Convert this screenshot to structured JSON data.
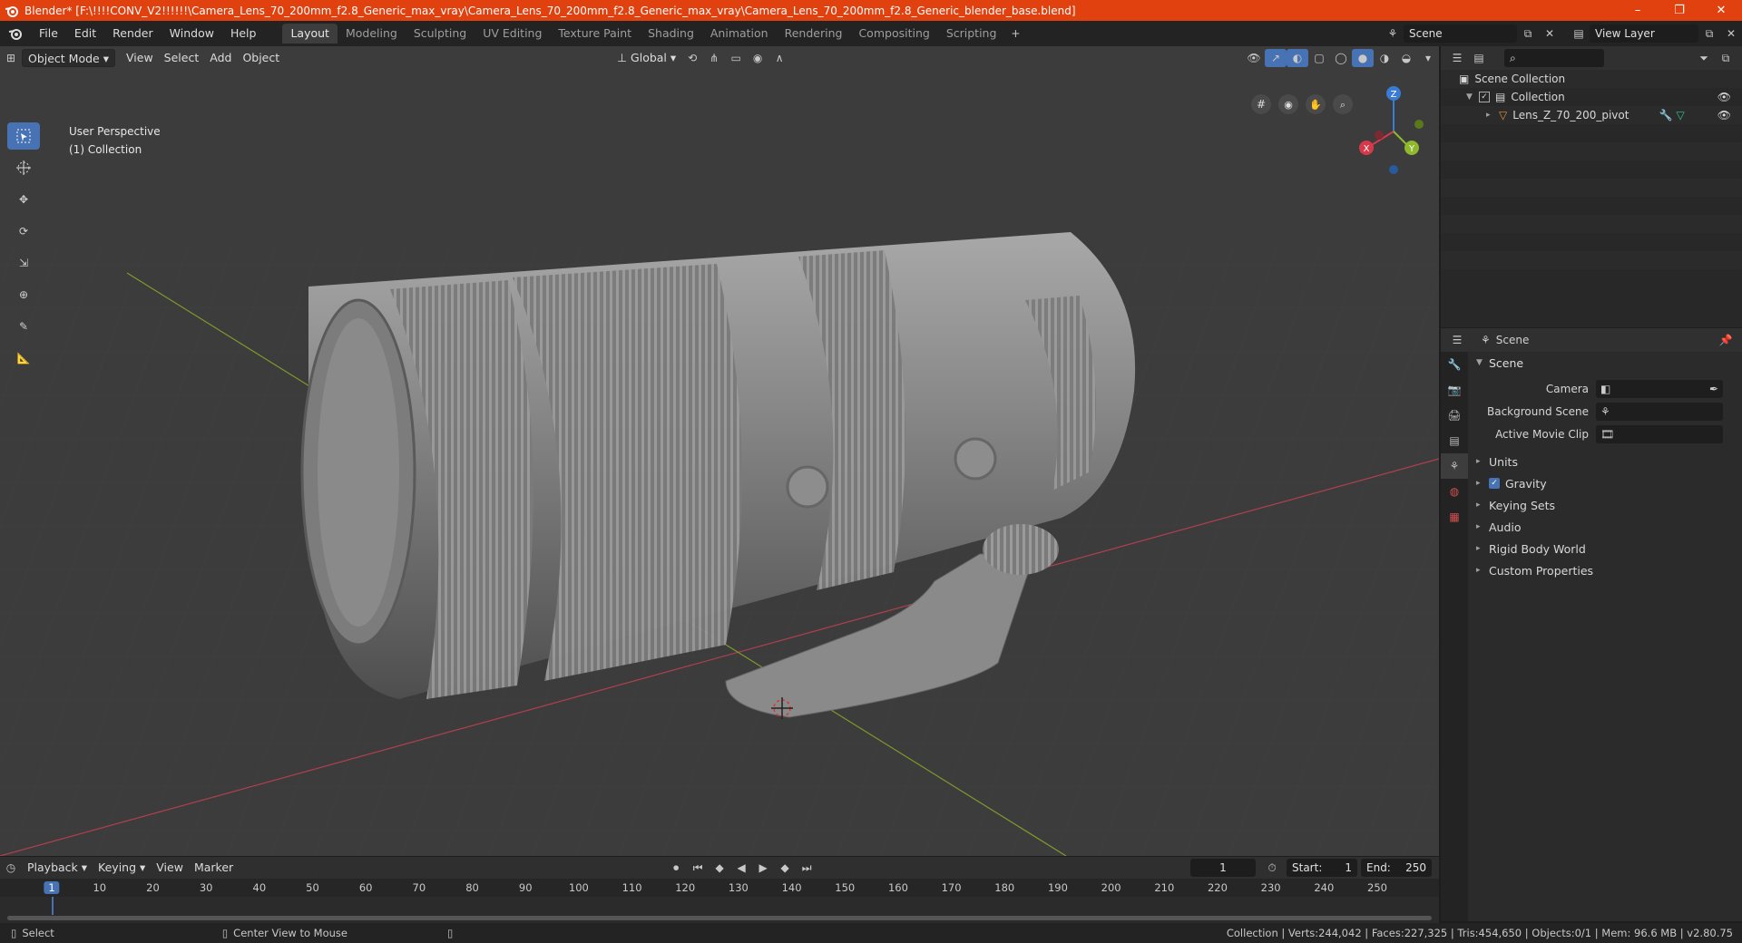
{
  "window": {
    "title": "Blender* [F:\\!!!!CONV_V2!!!!!!\\Camera_Lens_70_200mm_f2.8_Generic_max_vray\\Camera_Lens_70_200mm_f2.8_Generic_max_vray\\Camera_Lens_70_200mm_f2.8_Generic_blender_base.blend]",
    "minimize": "–",
    "maximize": "❐",
    "close": "✕"
  },
  "menubar": {
    "menus": [
      "File",
      "Edit",
      "Render",
      "Window",
      "Help"
    ],
    "workspaces": [
      "Layout",
      "Modeling",
      "Sculpting",
      "UV Editing",
      "Texture Paint",
      "Shading",
      "Animation",
      "Rendering",
      "Compositing",
      "Scripting"
    ],
    "active_workspace": "Layout",
    "scene": "Scene",
    "view_layer": "View Layer"
  },
  "viewport": {
    "mode": "Object Mode",
    "menus": [
      "View",
      "Select",
      "Add",
      "Object"
    ],
    "transform_orientation": "Global",
    "info_line1": "User Perspective",
    "info_line2": "(1) Collection",
    "gizmo": {
      "x": "X",
      "y": "Y",
      "z": "Z"
    }
  },
  "outliner": {
    "root": "Scene Collection",
    "collection": "Collection",
    "object": "Lens_Z_70_200_pivot"
  },
  "properties": {
    "context": "Scene",
    "panel": "Scene",
    "camera_label": "Camera",
    "background_label": "Background Scene",
    "movieclip_label": "Active Movie Clip",
    "subpanels": [
      "Units",
      "Gravity",
      "Keying Sets",
      "Audio",
      "Rigid Body World",
      "Custom Properties"
    ]
  },
  "timeline": {
    "menus": [
      "Playback",
      "Keying",
      "View",
      "Marker"
    ],
    "current_frame": "1",
    "start_label": "Start:",
    "start": "1",
    "end_label": "End:",
    "end": "250",
    "ticks": [
      "1",
      "10",
      "20",
      "30",
      "40",
      "50",
      "60",
      "70",
      "80",
      "90",
      "100",
      "110",
      "120",
      "130",
      "140",
      "150",
      "160",
      "170",
      "180",
      "190",
      "200",
      "210",
      "220",
      "230",
      "240",
      "250"
    ]
  },
  "statusbar": {
    "select": "Select",
    "center_view": "Center View to Mouse",
    "stats": "Collection | Verts:244,042 | Faces:227,325 | Tris:454,650 | Objects:0/1 | Mem: 96.6 MB | v2.80.75"
  },
  "colors": {
    "titlebar": "#e1410f",
    "accent": "#4772b3",
    "x_axis": "#d63a4a",
    "y_axis": "#8fb82c",
    "z_axis": "#3a7bd5"
  }
}
